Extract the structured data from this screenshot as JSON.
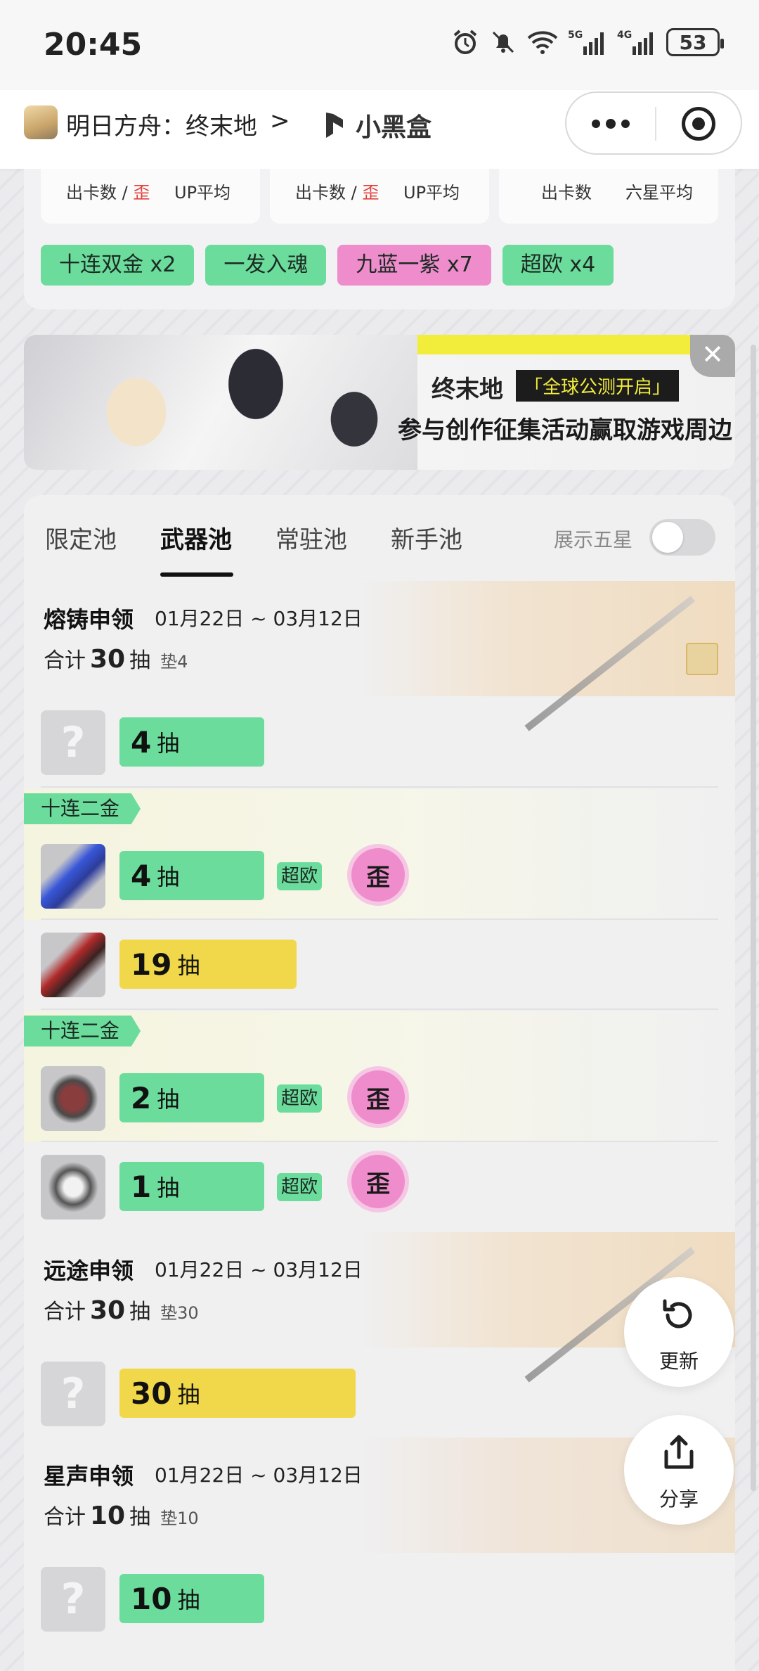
{
  "status_bar": {
    "time": "20:45",
    "battery": "53"
  },
  "nav": {
    "game_title": "明日方舟：终末地",
    "chevron": ">",
    "brand": "小黑盒"
  },
  "summary": {
    "stats": [
      {
        "a": "出卡数 / ",
        "a_red": "歪",
        "b": "UP平均"
      },
      {
        "a": "出卡数 / ",
        "a_red": "歪",
        "b": "UP平均"
      },
      {
        "a": "出卡数",
        "a_red": "",
        "b": "六星平均"
      }
    ],
    "tags": [
      {
        "label": "十连双金 x2",
        "color": "#6bdc9c"
      },
      {
        "label": "一发入魂",
        "color": "#6bdc9c"
      },
      {
        "label": "九蓝一紫 x7",
        "color": "#ef8ccc"
      },
      {
        "label": "超欧 x4",
        "color": "#6bdc9c"
      }
    ]
  },
  "banner": {
    "logo": "终末地",
    "badge": "「全球公测开启」",
    "slogan": "参与创作征集活动赢取游戏周边",
    "close": "✕"
  },
  "tabs": [
    {
      "label": "限定池",
      "active": false
    },
    {
      "label": "武器池",
      "active": true
    },
    {
      "label": "常驻池",
      "active": false
    },
    {
      "label": "新手池",
      "active": false
    }
  ],
  "toggle": {
    "label": "展示五星",
    "on": false
  },
  "pools": [
    {
      "name": "熔铸申领",
      "date": "01月22日 ~ 03月12日",
      "total_prefix": "合计",
      "total": "30",
      "unit": "抽",
      "pity": "垫4",
      "rows": [
        {
          "pulls": "4",
          "unit": "抽",
          "color": "green",
          "ribbon": "",
          "lucky": "",
          "crooked": ""
        },
        {
          "pulls": "4",
          "unit": "抽",
          "color": "green",
          "ribbon": "十连二金",
          "lucky": "超欧",
          "crooked": "歪"
        },
        {
          "pulls": "19",
          "unit": "抽",
          "color": "yellow",
          "ribbon": "",
          "lucky": "",
          "crooked": ""
        },
        {
          "pulls": "2",
          "unit": "抽",
          "color": "green",
          "ribbon": "十连二金",
          "lucky": "超欧",
          "crooked": "歪"
        },
        {
          "pulls": "1",
          "unit": "抽",
          "color": "green",
          "ribbon": "",
          "lucky": "超欧",
          "crooked": "歪"
        }
      ]
    },
    {
      "name": "远途申领",
      "date": "01月22日 ~ 03月12日",
      "total_prefix": "合计",
      "total": "30",
      "unit": "抽",
      "pity": "垫30",
      "rows": [
        {
          "pulls": "30",
          "unit": "抽",
          "color": "yellow"
        }
      ]
    },
    {
      "name": "星声申领",
      "date": "01月22日 ~ 03月12日",
      "total_prefix": "合计",
      "total": "10",
      "unit": "抽",
      "pity": "垫10",
      "rows": [
        {
          "pulls": "10",
          "unit": "抽",
          "color": "green"
        }
      ]
    }
  ],
  "float_buttons": {
    "refresh": "更新",
    "share": "分享"
  },
  "colors": {
    "green": "#6bdc9c",
    "yellow": "#f1d84a",
    "pink": "#ef8ccc",
    "red": "#e0413a"
  }
}
